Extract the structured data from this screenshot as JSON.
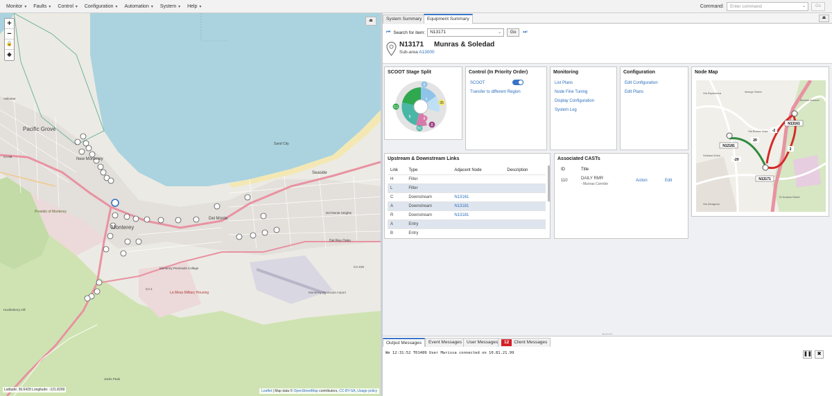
{
  "menu": [
    {
      "label": "Monitor"
    },
    {
      "label": "Faults"
    },
    {
      "label": "Control"
    },
    {
      "label": "Configuration"
    },
    {
      "label": "Automation"
    },
    {
      "label": "System"
    },
    {
      "label": "Help"
    }
  ],
  "command": {
    "label": "Command:",
    "placeholder": "Enter command",
    "go": "Go"
  },
  "map": {
    "zoom_in": "+",
    "zoom_out": "−",
    "coords": "Latitude: 36.6429 Longitude: -121.8299",
    "attribution": {
      "leaflet": "Leaflet",
      "sep1": " | Map data © ",
      "osm": "OpenStreetMap",
      "contrib": " contributors, ",
      "license": "CC-BY-SA",
      "sep2": ", ",
      "usage": "Usage policy"
    },
    "labels": [
      {
        "text": "Pacific Grove"
      },
      {
        "text": "New Monterey"
      },
      {
        "text": "Monterey"
      },
      {
        "text": "Seaside"
      },
      {
        "text": "Del Monte"
      },
      {
        "text": "Sand City"
      },
      {
        "text": "Del Rey Oaks"
      },
      {
        "text": "Presidio of Monterey"
      },
      {
        "text": "Monterey Peninsula Airport"
      },
      {
        "text": "La Mesa Military Housing"
      },
      {
        "text": "Monterey Peninsula College"
      },
      {
        "text": "CA 68"
      },
      {
        "text": "CA 1"
      },
      {
        "text": "CA 218"
      },
      {
        "text": "Jacks Peak"
      },
      {
        "text": "Huckleberry Hill"
      },
      {
        "text": "Asilomar"
      },
      {
        "text": "Del Monte Heights"
      }
    ],
    "colors": {
      "water": "#aad3df",
      "land": "#f2efe9",
      "park": "#c8dfa8",
      "urban": "#e6e1da",
      "highway": "#e892a2",
      "beach": "#f3e8b4"
    }
  },
  "tabs": [
    {
      "label": "System Summary"
    },
    {
      "label": "Equipment Summary"
    }
  ],
  "search": {
    "label": "Search for item:",
    "value": "N13171",
    "go": "Go"
  },
  "node": {
    "id": "N13171",
    "name": "Munras & Soledad",
    "subarea_label": "Sub-area",
    "subarea": "A13000"
  },
  "stage_split": {
    "title": "SCOOT Stage Split",
    "colors": {
      "green": "#2fa84f",
      "teal": "#49b6a6",
      "blue": "#8fc4e8",
      "yellow": "#f4ea6a",
      "pink": "#d87aa9",
      "purple": "#a0458a",
      "grey": "#dcdcdc"
    },
    "labels": [
      "6",
      "2",
      "35",
      "8",
      "8",
      "8",
      "C1",
      "B2"
    ]
  },
  "control": {
    "title": "Control (In Priority Order)",
    "items": [
      "SCOOT",
      "Transfer to different Region"
    ],
    "scoot_enabled": true
  },
  "monitoring": {
    "title": "Monitoring",
    "items": [
      "List Plans",
      "Node Fine Tuning",
      "Display Configuration",
      "System Log"
    ]
  },
  "configuration": {
    "title": "Configuration",
    "items": [
      "Edit Configuration",
      "Edit Plans"
    ]
  },
  "node_map": {
    "title": "Node Map",
    "nodes": [
      "N12181",
      "N13161",
      "N13171"
    ],
    "values": [
      "20",
      "-20",
      "-2",
      "2"
    ],
    "streets": [
      "Via Esperanza",
      "Abrego Street",
      "Munras Avenue",
      "Soledad Drive",
      "Via Buena Vista",
      "Via Zaragoza",
      "El Dorado Street"
    ]
  },
  "links": {
    "title": "Upstream & Downstream Links",
    "headers": [
      "Link",
      "Type",
      "Adjacent Node",
      "Description"
    ],
    "rows": [
      {
        "link": "H",
        "type": "Filter",
        "node": "",
        "desc": ""
      },
      {
        "link": "L",
        "type": "Filter",
        "node": "",
        "desc": ""
      },
      {
        "link": "C",
        "type": "Downstream",
        "node": "N13161",
        "desc": ""
      },
      {
        "link": "A",
        "type": "Downstream",
        "node": "N13181",
        "desc": ""
      },
      {
        "link": "R",
        "type": "Downstream",
        "node": "N13181",
        "desc": ""
      },
      {
        "link": "A",
        "type": "Entry",
        "node": "",
        "desc": ""
      },
      {
        "link": "B",
        "type": "Entry",
        "node": "",
        "desc": ""
      }
    ]
  },
  "casts": {
    "title": "Associated CASTs",
    "headers": [
      "ID",
      "Title"
    ],
    "rows": [
      {
        "id": "110",
        "title": "DAILY RMR",
        "sub": "- Munras Corridor",
        "action": "Action",
        "edit": "Edit"
      }
    ]
  },
  "messages": {
    "tabs": [
      "Output Messages",
      "Event Messages",
      "User Messages",
      "Client Messages"
    ],
    "client_count": "12",
    "line": "We 12:31:52 T01489 User Marissa connected on 10.81.21.99",
    "pause": "❚❚",
    "close": "✖"
  }
}
